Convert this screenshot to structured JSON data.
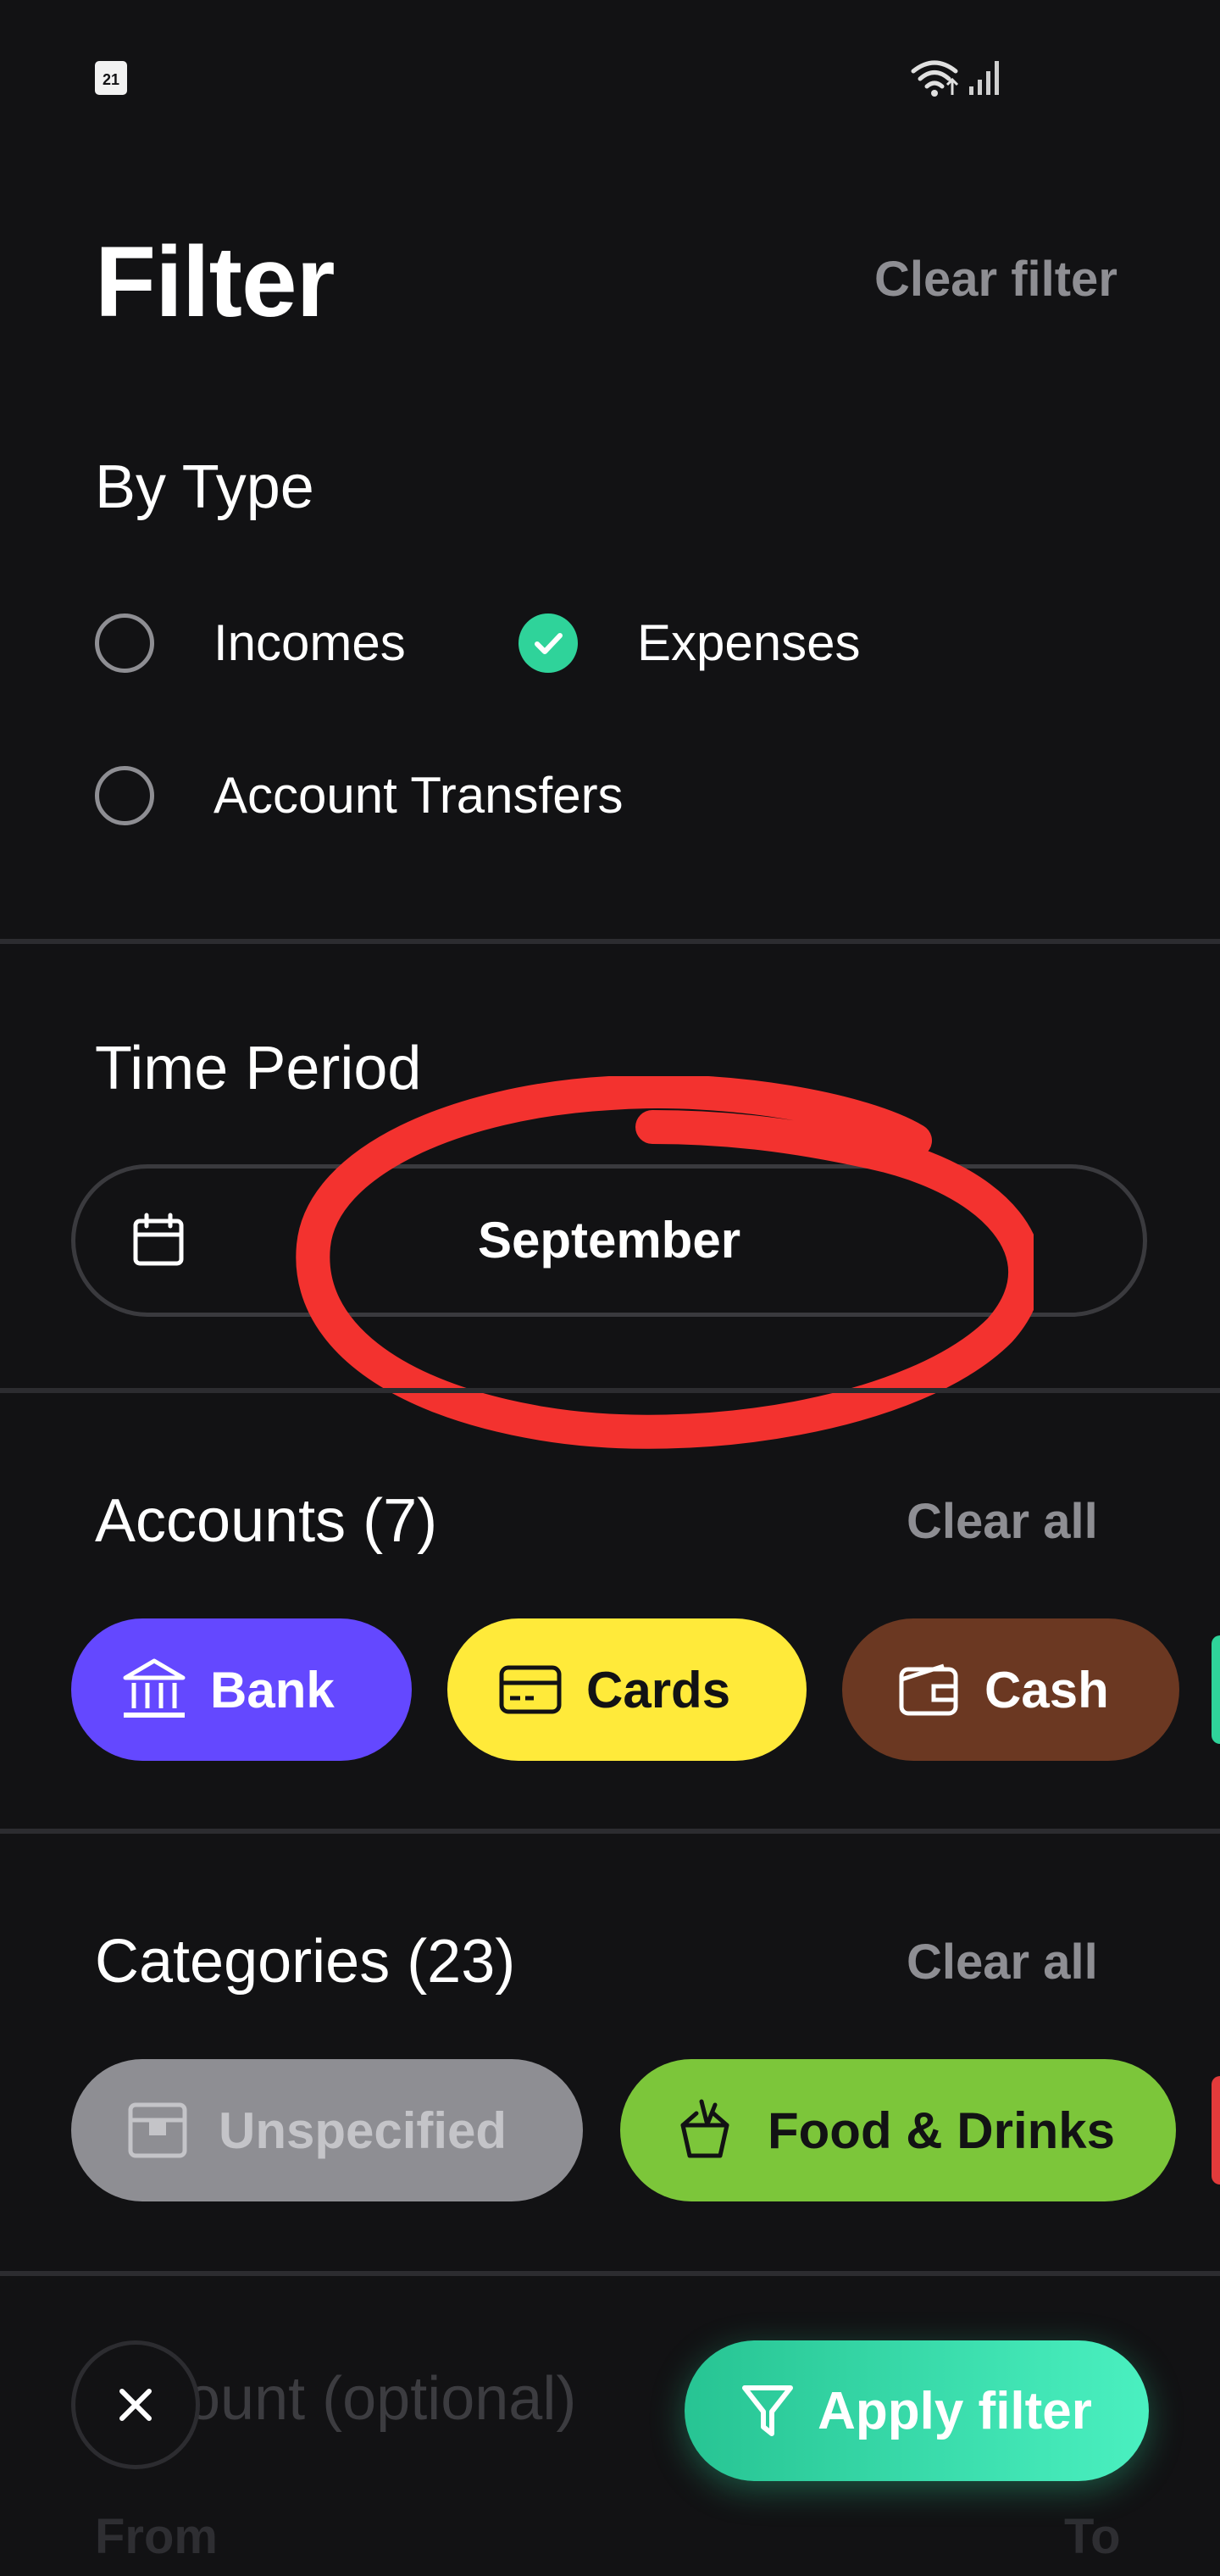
{
  "status_bar": {
    "date": "21"
  },
  "header": {
    "title": "Filter",
    "clear_label": "Clear filter"
  },
  "by_type": {
    "title": "By Type",
    "options": [
      {
        "label": "Incomes",
        "checked": false
      },
      {
        "label": "Expenses",
        "checked": true
      },
      {
        "label": "Account Transfers",
        "checked": false
      }
    ]
  },
  "time_period": {
    "title": "Time Period",
    "value": "September"
  },
  "accounts": {
    "title": "Accounts (7)",
    "clear_label": "Clear all",
    "chips": [
      {
        "label": "Bank",
        "icon": "bank-icon",
        "color": "#6448ff"
      },
      {
        "label": "Cards",
        "icon": "credit-card-icon",
        "color": "#ffea3a"
      },
      {
        "label": "Cash",
        "icon": "wallet-icon",
        "color": "#6b3822"
      }
    ]
  },
  "categories": {
    "title": "Categories (23)",
    "clear_label": "Clear all",
    "chips": [
      {
        "label": "Unspecified",
        "icon": "box-icon",
        "color": "#8e8e93"
      },
      {
        "label": "Food & Drinks",
        "icon": "takeout-box-icon",
        "color": "#7cc63a"
      }
    ]
  },
  "amount": {
    "title": "Amount (optional)",
    "from_label": "From",
    "to_label": "To"
  },
  "actions": {
    "apply_label": "Apply filter"
  },
  "annotation_color": "#f3322f"
}
